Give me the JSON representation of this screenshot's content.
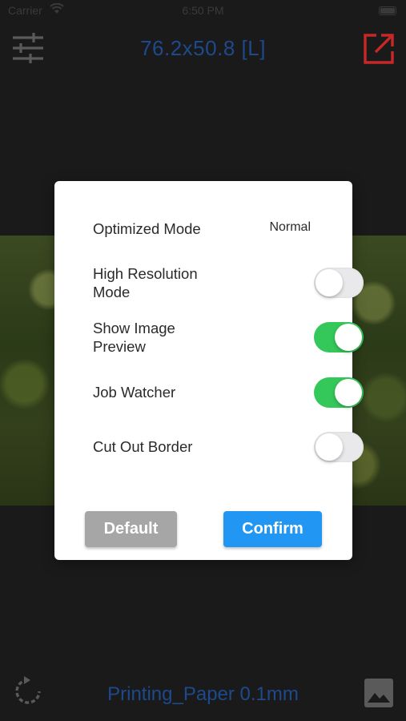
{
  "status_bar": {
    "carrier": "Carrier",
    "time": "6:50 PM"
  },
  "header": {
    "title": "76.2x50.8 [L]",
    "title_color": "#1d4a8c",
    "left_icon": "settings-sliders-icon",
    "right_icon": "export-icon",
    "right_icon_color": "#c62828"
  },
  "dialog": {
    "optimized_mode": {
      "label": "Optimized Mode",
      "value": "Normal"
    },
    "settings": [
      {
        "label": "High Resolution Mode",
        "enabled": false
      },
      {
        "label": "Show Image Preview",
        "enabled": true
      },
      {
        "label": "Job Watcher",
        "enabled": true
      },
      {
        "label": "Cut Out Border",
        "enabled": false
      }
    ],
    "default_label": "Default",
    "confirm_label": "Confirm",
    "toggle_on_color": "#34c759",
    "confirm_color": "#2196f3"
  },
  "footer": {
    "paper_label": "Printing_Paper 0.1mm",
    "left_icon": "refresh-icon",
    "right_icon": "gallery-icon"
  }
}
